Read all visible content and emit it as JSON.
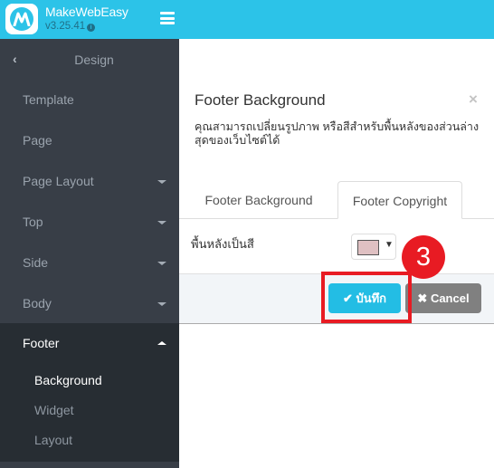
{
  "header": {
    "brand": "MakeWebEasy",
    "version": "v3.25.41",
    "info_icon": "i",
    "accent_color": "#2cc3e8"
  },
  "sidebar": {
    "title": "Design",
    "back_icon": "‹",
    "items": [
      {
        "label": "Template",
        "has_caret": false
      },
      {
        "label": "Page",
        "has_caret": false
      },
      {
        "label": "Page Layout",
        "has_caret": true
      },
      {
        "label": "Top",
        "has_caret": true
      },
      {
        "label": "Side",
        "has_caret": true
      },
      {
        "label": "Body",
        "has_caret": true
      }
    ],
    "footer_group": {
      "label": "Footer",
      "expanded": true,
      "sub_items": [
        {
          "label": "Background",
          "active": true
        },
        {
          "label": "Widget",
          "active": false
        },
        {
          "label": "Layout",
          "active": false
        }
      ]
    }
  },
  "modal": {
    "title": "Footer Background",
    "close_icon": "×",
    "description": "คุณสามารถเปลี่ยนรูปภาพ หรือสีสำหรับพื้นหลังของส่วนล่างสุดของเว็บไซต์ได้",
    "tabs": [
      {
        "label": "Footer Background",
        "active": false
      },
      {
        "label": "Footer Copyright",
        "active": true
      }
    ],
    "field_label": "พื้นหลังเป็นสี",
    "color_value": "#dfc0c2",
    "picker_caret": "▼",
    "save_label": "บันทึก",
    "save_icon": "✔",
    "cancel_label": "Cancel",
    "cancel_icon": "✖"
  },
  "annotation": {
    "step_number": "3",
    "color": "#e81b23"
  }
}
